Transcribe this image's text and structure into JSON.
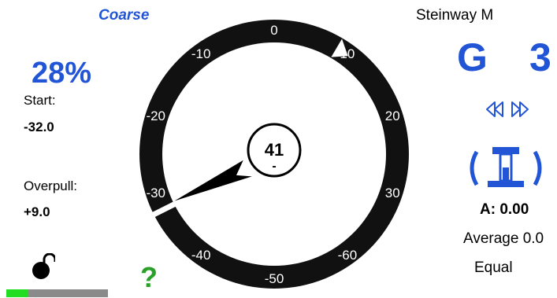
{
  "mode_label": "Coarse",
  "percent": "28%",
  "start": {
    "label": "Start:",
    "value": "-32.0"
  },
  "overpull": {
    "label": "Overpull:",
    "value": "+9.0"
  },
  "lock_icon": "unlocked-padlock-icon",
  "progress_fraction": 0.22,
  "help_label": "?",
  "piano_name": "Steinway M",
  "note": {
    "name": "G",
    "octave": "3"
  },
  "nav_icons": [
    "rewind-icon",
    "fast-forward-icon"
  ],
  "mute_icon": "piano-mute-strip-icon",
  "a_value": "A: 0.00",
  "average": "Average 0.0",
  "temperament": "Equal",
  "dial": {
    "center_value": "41",
    "center_sub": "-",
    "scale_labels": [
      "0",
      "10",
      "20",
      "30",
      "-60",
      "-50",
      "-40",
      "-30",
      "-20",
      "-10"
    ],
    "needle_value": -32,
    "marker_value": 9
  },
  "colors": {
    "accent_blue": "#2255d6",
    "help_green": "#2aa02a",
    "progress_green": "#22dd22",
    "progress_track": "#8a8a8a"
  }
}
